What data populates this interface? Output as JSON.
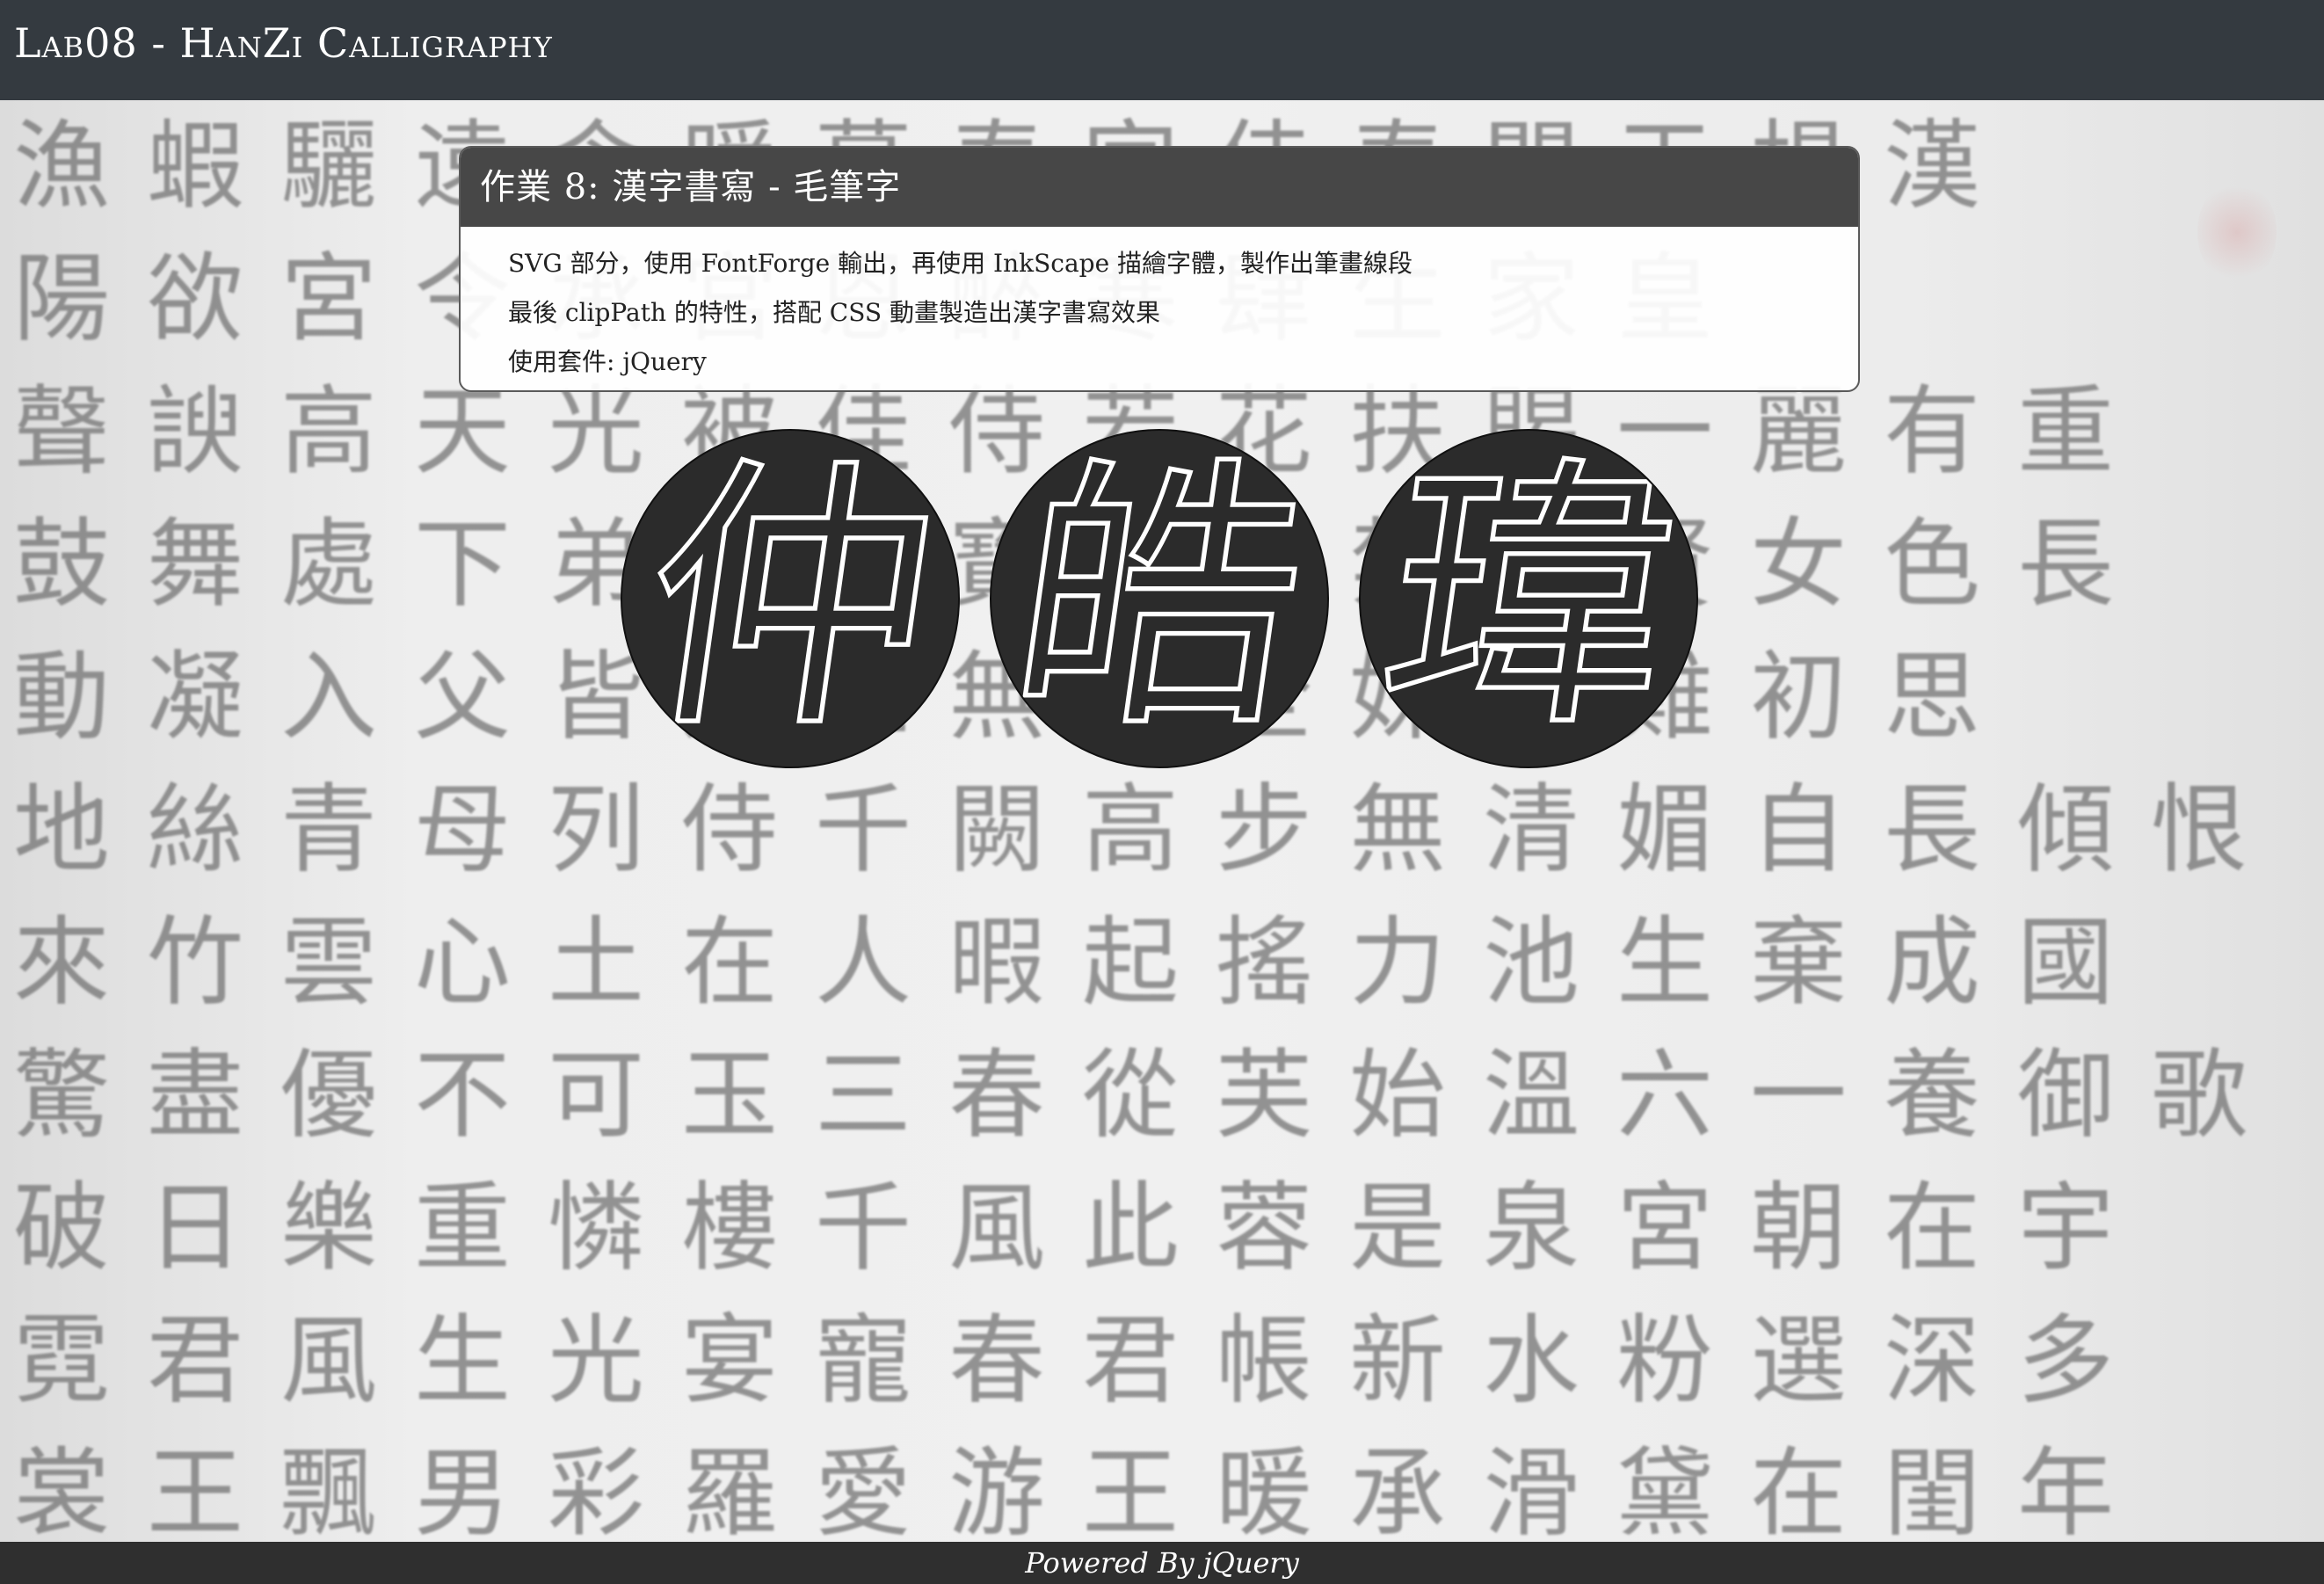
{
  "navbar": {
    "brand": "Lab08 - HanZi Calligraphy"
  },
  "card": {
    "title": "作業 8: 漢字書寫 - 毛筆字",
    "lines": [
      "SVG 部分，使用 FontForge 輸出，再使用 InkScape 描繪字體，製作出筆畫線段",
      "最後 clipPath 的特性，搭配 CSS 動畫製造出漢字書寫效果",
      "使用套件: jQuery"
    ]
  },
  "characters": [
    {
      "glyph": "仲"
    },
    {
      "glyph": "皓"
    },
    {
      "glyph": "瑋"
    }
  ],
  "background": {
    "rows": [
      "漁蝦驪遠含暖暮春宮侍春聞天楊漢",
      "陽欲宮令承宮恩醉寒肆生家皇",
      "聲諛高天光被佳侍若花扶賜一麗有重",
      "鼓舞處下弟於此寶姊妹禁宮賢女色長",
      "動凝入父皆姊三無鉤全姊右難初思",
      "地絲青母列侍千闕高步無清媚自長傾恨",
      "來竹雲心土在人暇起搖力池生棄成國",
      "驚盡優不可玉三春從芙始溫六一養御歌",
      "破日樂重憐樓千風此蓉是泉宮朝在宇",
      "霓君風生光宴寵春君帳新水粉選深多",
      "裳王飄男彩羅愛游王暖承滑黛在閨年"
    ]
  },
  "footer": {
    "text": "Powered By jQuery"
  },
  "colors": {
    "navbar_bg": "#343a40",
    "card_header_bg": "#474747",
    "disc_bg": "#2b2b2b",
    "stroke": "#ffffff",
    "footer_bg": "#2f2f2f"
  }
}
